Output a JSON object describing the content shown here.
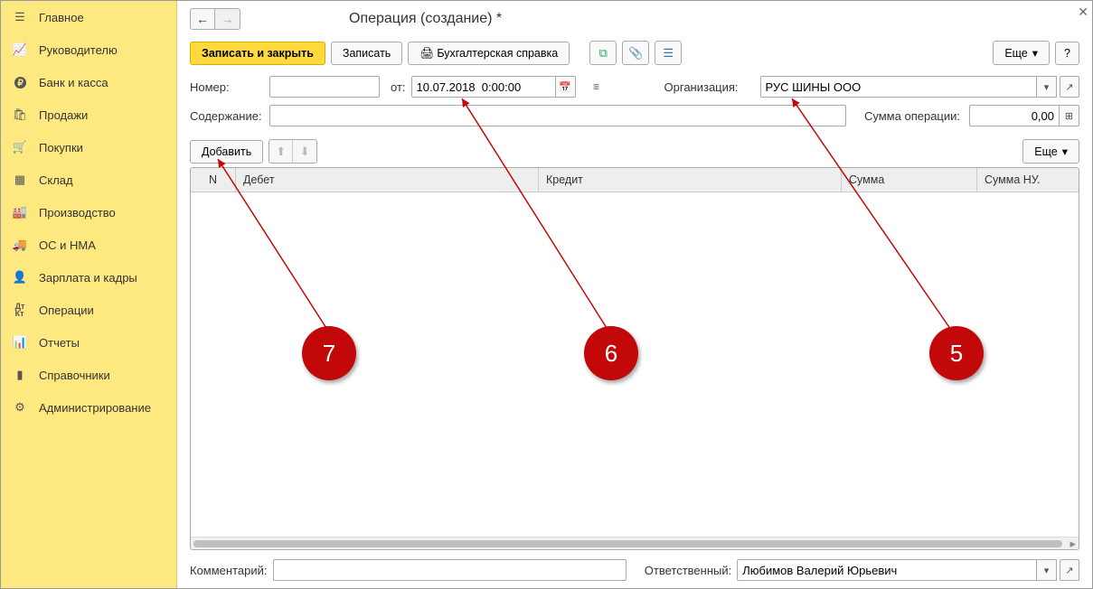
{
  "sidebar": {
    "items": [
      {
        "label": "Главное",
        "icon": "menu"
      },
      {
        "label": "Руководителю",
        "icon": "chart"
      },
      {
        "label": "Банк и касса",
        "icon": "ruble"
      },
      {
        "label": "Продажи",
        "icon": "bag"
      },
      {
        "label": "Покупки",
        "icon": "cart"
      },
      {
        "label": "Склад",
        "icon": "boxes"
      },
      {
        "label": "Производство",
        "icon": "factory"
      },
      {
        "label": "ОС и НМА",
        "icon": "truck"
      },
      {
        "label": "Зарплата и кадры",
        "icon": "person"
      },
      {
        "label": "Операции",
        "icon": "dtct"
      },
      {
        "label": "Отчеты",
        "icon": "bars"
      },
      {
        "label": "Справочники",
        "icon": "book"
      },
      {
        "label": "Администрирование",
        "icon": "gear"
      }
    ]
  },
  "header": {
    "title": "Операция (создание) *"
  },
  "toolbar": {
    "save_close": "Записать и закрыть",
    "save": "Записать",
    "report": "Бухгалтерская справка",
    "more": "Еще",
    "help": "?"
  },
  "form": {
    "number_label": "Номер:",
    "number_value": "",
    "from_label": "от:",
    "date_value": "10.07.2018  0:00:00",
    "org_label": "Организация:",
    "org_value": "РУС ШИНЫ ООО",
    "content_label": "Содержание:",
    "content_value": "",
    "sum_label": "Сумма операции:",
    "sum_value": "0,00"
  },
  "table_toolbar": {
    "add": "Добавить",
    "more": "Еще"
  },
  "table": {
    "headers": [
      "N",
      "Дебет",
      "Кредит",
      "Сумма",
      "Сумма НУ."
    ]
  },
  "footer": {
    "comment_label": "Комментарий:",
    "comment_value": "",
    "responsible_label": "Ответственный:",
    "responsible_value": "Любимов Валерий Юрьевич"
  },
  "annotations": {
    "a5": "5",
    "a6": "6",
    "a7": "7"
  }
}
